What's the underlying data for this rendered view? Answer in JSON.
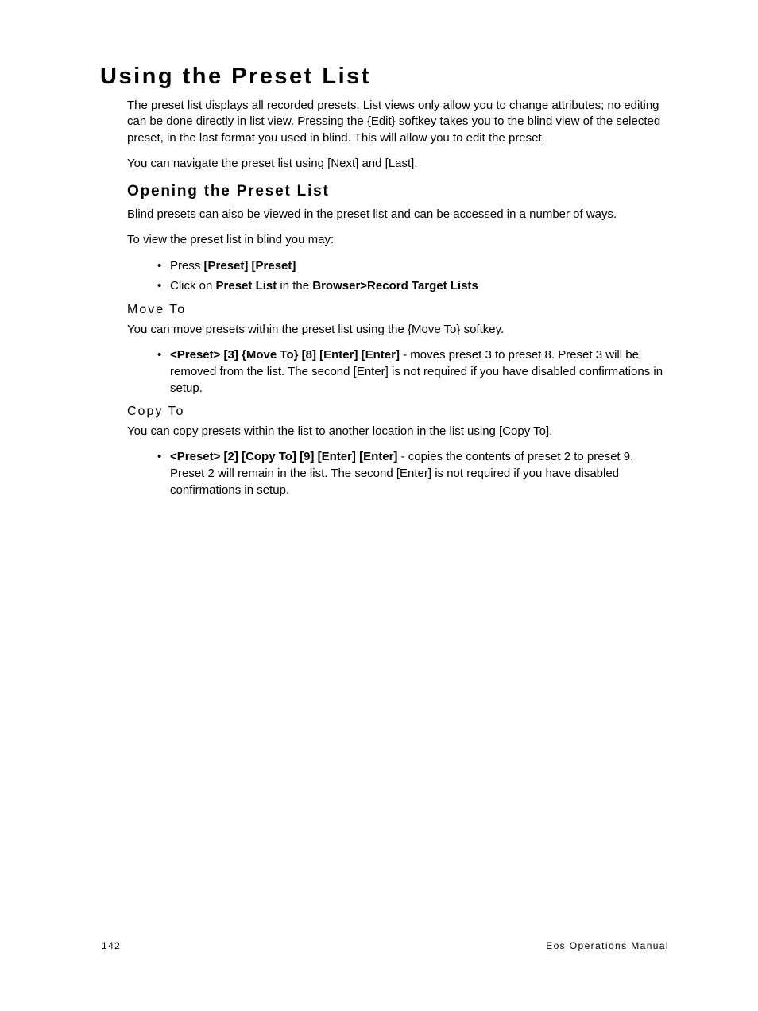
{
  "title": "Using the Preset List",
  "intro1": "The preset list displays all recorded presets. List views only allow you to change attributes; no editing can be done directly in list view. Pressing the {Edit} softkey takes you to the blind view of the selected preset, in the last format you used in blind. This will allow you to edit the preset.",
  "intro2": "You can navigate the preset list using [Next] and [Last].",
  "open": {
    "heading": "Opening the Preset List",
    "p1": "Blind presets can also be viewed in the preset list and can be accessed in a number of ways.",
    "p2": "To view the preset list in blind you may:",
    "b1_lead": "Press ",
    "b1_bold": "[Preset] [Preset]",
    "b2_lead": "Click on ",
    "b2_bold1": "Preset List",
    "b2_mid": " in the ",
    "b2_bold2": "Browser>Record Target Lists"
  },
  "move": {
    "heading": "Move To",
    "p": "You can move presets within the preset list using the {Move To} softkey.",
    "b1_bold": "<Preset> [3] {Move To} [8] [Enter] [Enter]",
    "b1_rest": " - moves preset 3 to preset 8. Preset 3 will be removed from the list. The second [Enter] is not required if you have disabled confirmations in setup."
  },
  "copy": {
    "heading": "Copy To",
    "p": "You can copy presets within the list to another location in the list using [Copy To].",
    "b1_bold": "<Preset> [2] [Copy To] [9] [Enter] [Enter]",
    "b1_rest": " - copies the contents of preset 2 to preset 9. Preset 2 will remain in the list. The second [Enter] is not required if you have disabled confirmations in setup."
  },
  "footer": {
    "page": "142",
    "doc": "Eos Operations Manual"
  }
}
